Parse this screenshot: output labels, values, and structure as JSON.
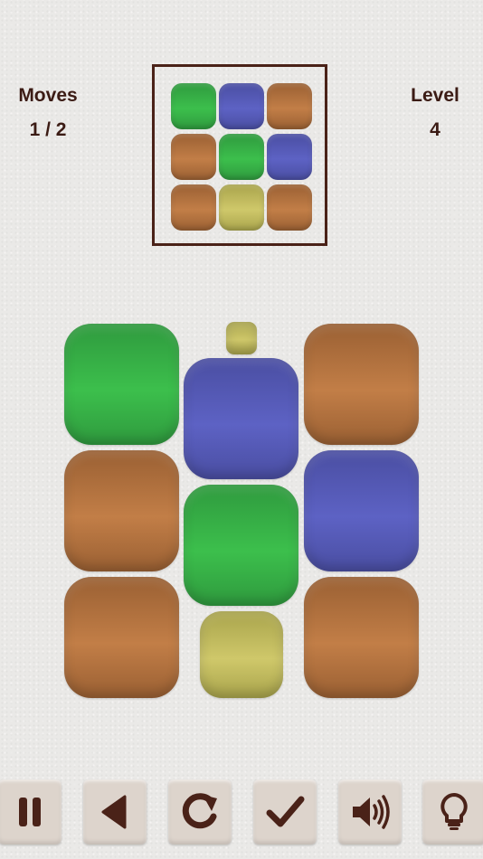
{
  "stats": {
    "moves_label": "Moves",
    "moves_value": "1 / 2",
    "level_label": "Level",
    "level_value": "4"
  },
  "colors": {
    "green": "#3cbf4c",
    "blue": "#5d62c4",
    "brown": "#c27e47",
    "olive": "#cfc86a",
    "ink": "#4a2218"
  },
  "target_pattern": [
    [
      "green",
      "blue",
      "brown"
    ],
    [
      "brown",
      "green",
      "blue"
    ],
    [
      "brown",
      "olive",
      "brown"
    ]
  ],
  "board": {
    "columns": [
      [
        "green",
        "brown",
        "brown"
      ],
      [
        "olive",
        "blue",
        "green",
        "olive"
      ],
      [
        "brown",
        "blue",
        "brown"
      ]
    ]
  },
  "toolbar": [
    {
      "name": "pause",
      "icon": "pause-icon"
    },
    {
      "name": "back",
      "icon": "back-arrow-icon"
    },
    {
      "name": "restart",
      "icon": "restart-icon"
    },
    {
      "name": "check",
      "icon": "checkmark-icon"
    },
    {
      "name": "sound",
      "icon": "speaker-icon"
    },
    {
      "name": "hint",
      "icon": "lightbulb-icon"
    }
  ]
}
